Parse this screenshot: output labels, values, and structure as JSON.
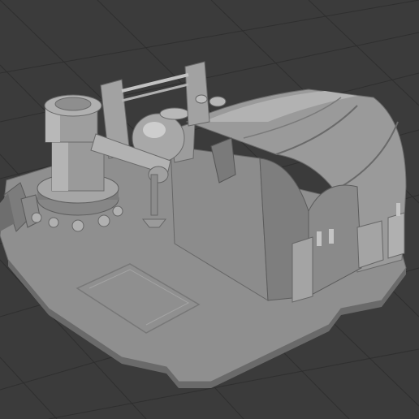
{
  "viewport": {
    "background": "#3b3b3b",
    "grid_color": "#2f2f2f",
    "grid_visible": true,
    "model": {
      "description_hidden": true,
      "base_color": "#8c8c8c",
      "shadow_color": "#555555",
      "highlight_color": "#c8c8c8"
    }
  }
}
